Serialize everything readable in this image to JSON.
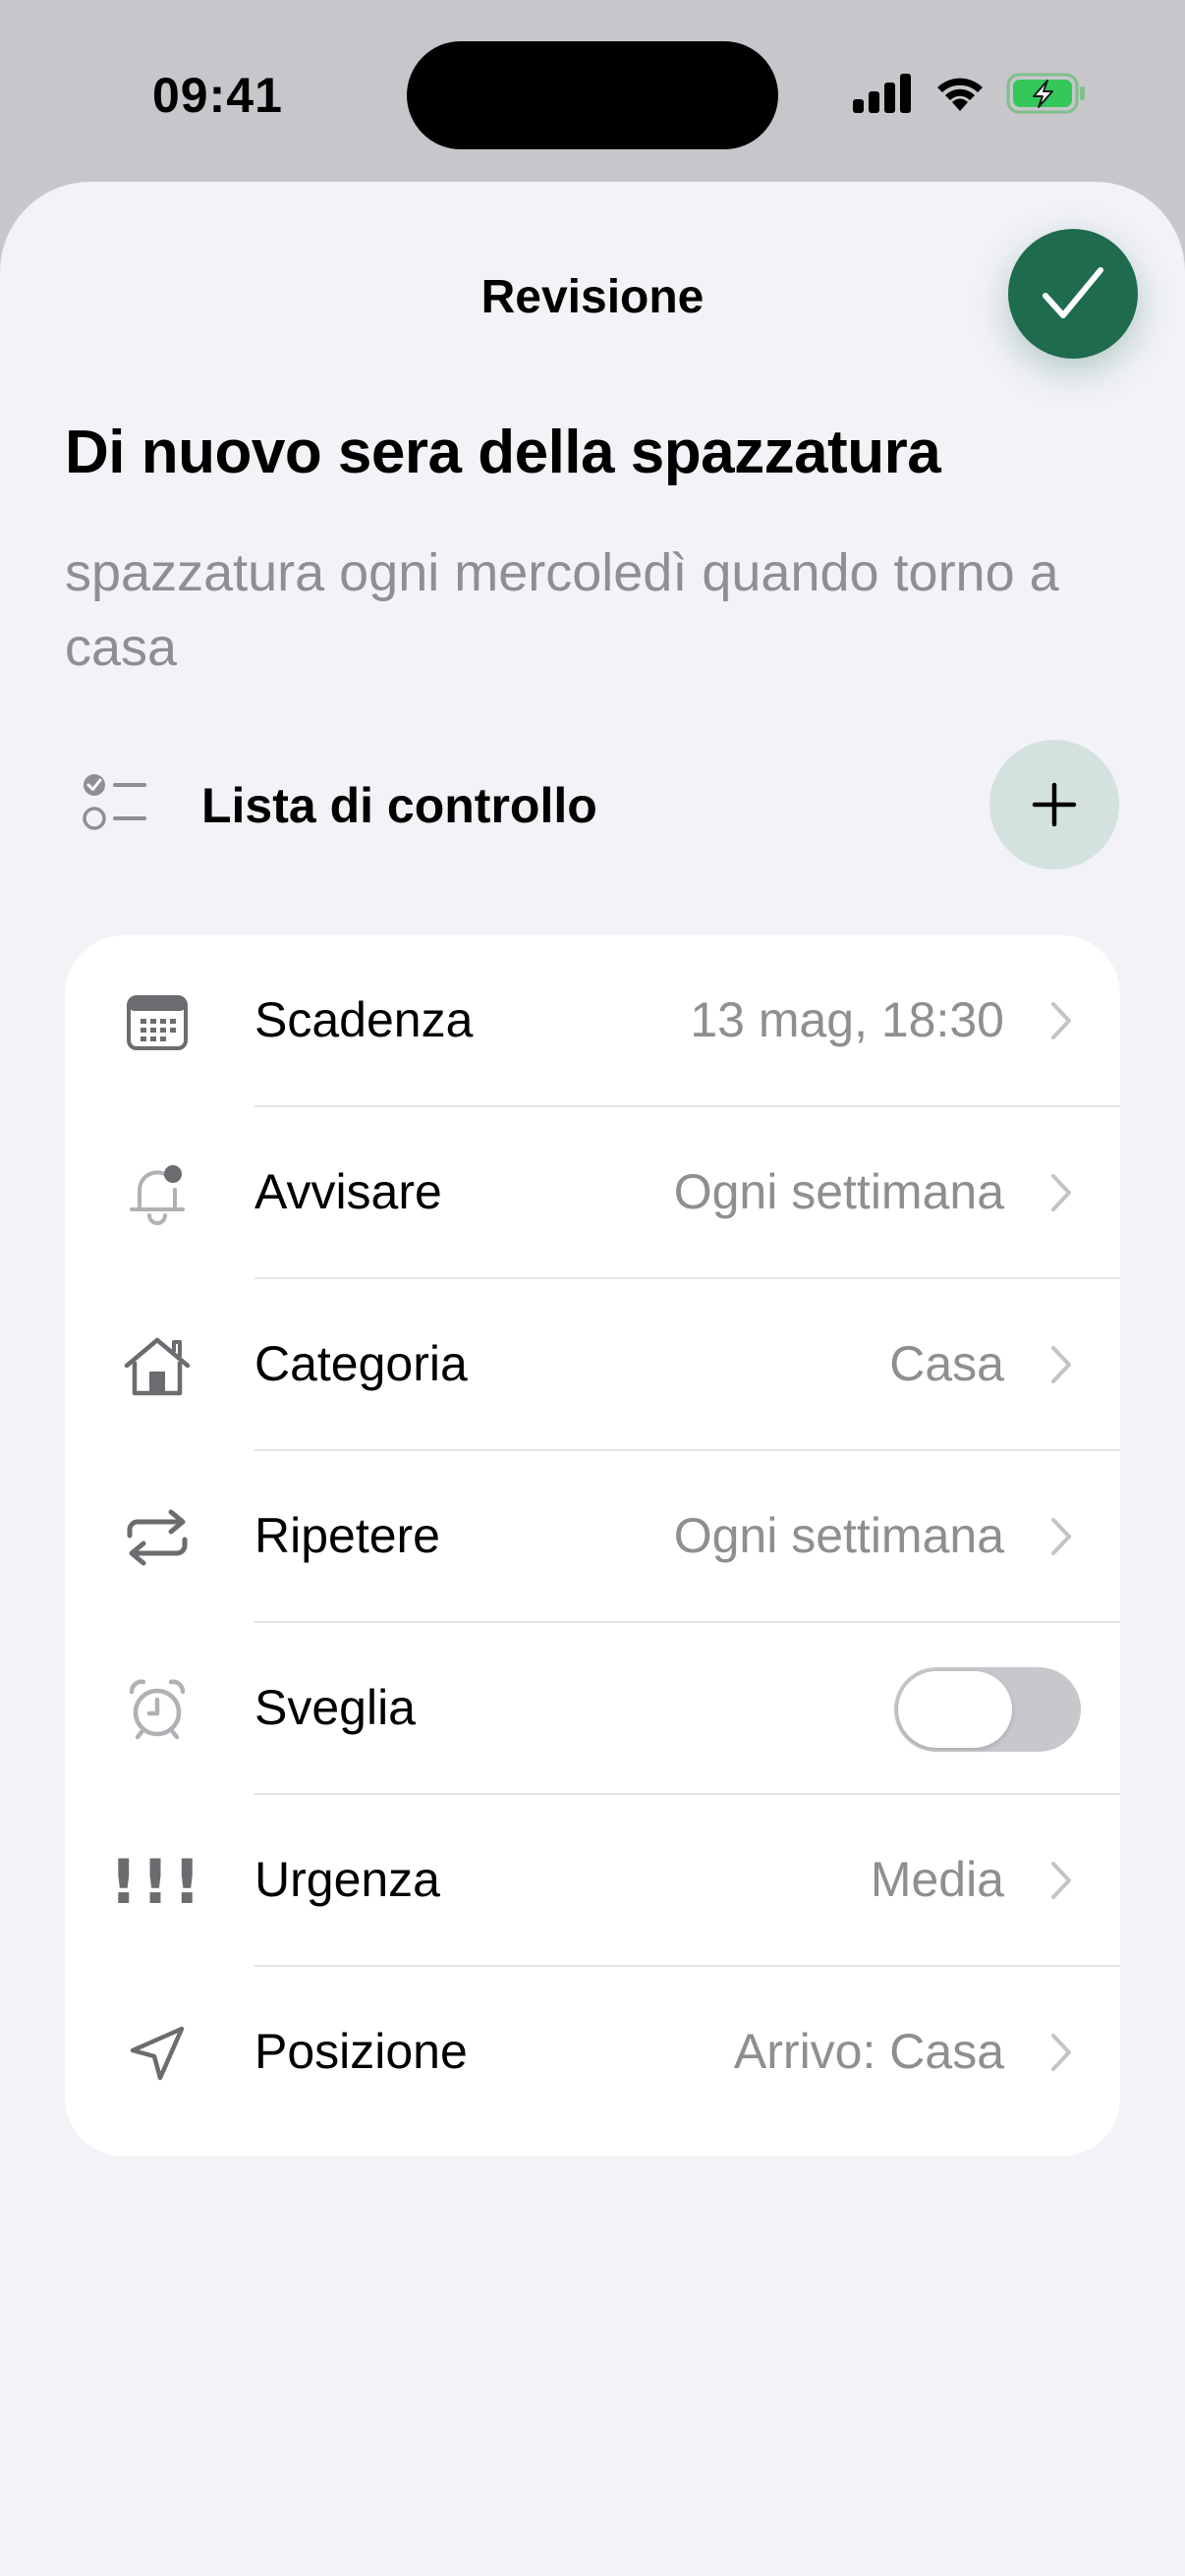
{
  "status_bar": {
    "time": "09:41"
  },
  "sheet": {
    "title": "Revisione",
    "done_icon": "checkmark-icon"
  },
  "task": {
    "title": "Di nuovo sera della spazzatura",
    "notes": "spazzatura ogni mercoledì quando torno a casa"
  },
  "checklist": {
    "label": "Lista di controllo",
    "add_icon": "plus-icon"
  },
  "details": [
    {
      "label": "Scadenza",
      "value": "13 mag, 18:30",
      "icon": "calendar-icon"
    },
    {
      "label": "Avvisare",
      "value": "Ogni settimana",
      "icon": "bell-icon"
    },
    {
      "label": "Categoria",
      "value": "Casa",
      "icon": "house-icon"
    },
    {
      "label": "Ripetere",
      "value": "Ogni settimana",
      "icon": "repeat-icon"
    },
    {
      "label": "Sveglia",
      "toggle_on": false,
      "icon": "alarm-clock-icon"
    },
    {
      "label": "Urgenza",
      "value": "Media",
      "icon": "exclamation-icon",
      "glyph": "!!!"
    },
    {
      "label": "Posizione",
      "value": "Arrivo: Casa",
      "icon": "location-arrow-icon"
    }
  ],
  "colors": {
    "accent": "#1e6b4e",
    "accent_soft": "#d3e2de",
    "sheet_bg": "#f2f2f7",
    "secondary_text": "#8e8e93",
    "battery": "#34c759"
  }
}
